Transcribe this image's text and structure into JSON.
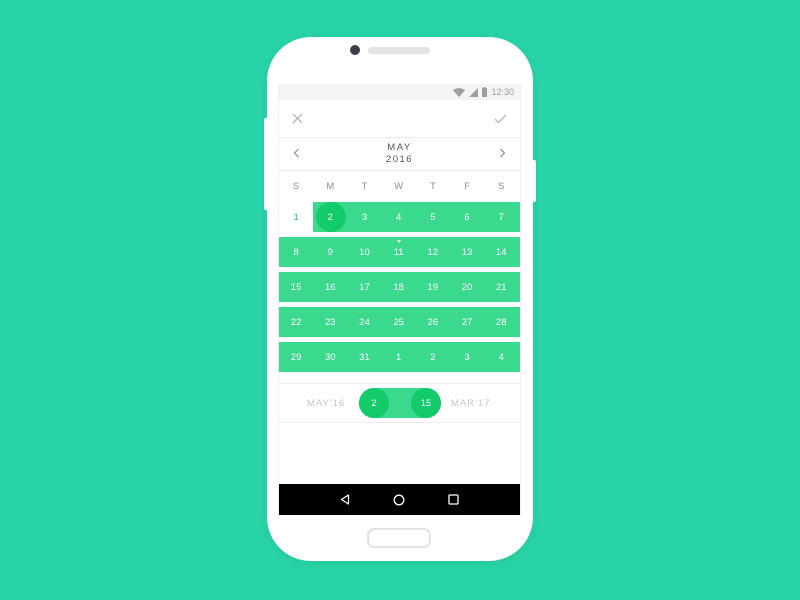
{
  "status_bar": {
    "time": "12:30",
    "icons": [
      "wifi-icon",
      "signal-icon",
      "battery-icon"
    ]
  },
  "toolbar": {
    "close_icon": "close-icon",
    "confirm_icon": "check-icon"
  },
  "calendar": {
    "month": "MAY",
    "year": "2016",
    "prev_icon": "chevron-left-icon",
    "next_icon": "chevron-right-icon",
    "weekdays": [
      "S",
      "M",
      "T",
      "W",
      "T",
      "F",
      "S"
    ],
    "weeks": [
      [
        "1",
        "2",
        "3",
        "4",
        "5",
        "6",
        "7"
      ],
      [
        "8",
        "9",
        "10",
        "11",
        "12",
        "13",
        "14"
      ],
      [
        "15",
        "16",
        "17",
        "18",
        "19",
        "20",
        "21"
      ],
      [
        "22",
        "23",
        "24",
        "25",
        "26",
        "27",
        "28"
      ],
      [
        "29",
        "30",
        "31",
        "1",
        "2",
        "3",
        "4"
      ]
    ],
    "selected_day": "2",
    "today_marker_day": "11"
  },
  "range": {
    "start_label": "MAY'16",
    "start_value": "2",
    "end_value": "15",
    "end_label": "MAR'17"
  },
  "nav_bar": {
    "icons": [
      "back-icon",
      "home-icon",
      "recents-icon"
    ]
  },
  "colors": {
    "background": "#27D3A6",
    "band": "#3AD98E",
    "accent": "#13CB6A"
  }
}
